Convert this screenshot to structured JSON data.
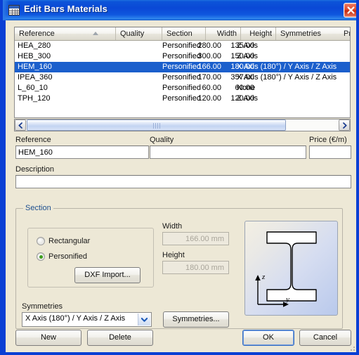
{
  "window": {
    "title": "Edit Bars Materials",
    "icon": "table-grid-icon",
    "close_label": "×",
    "accent_title_bg": "#0A48D6",
    "dialog_bg": "#EDE8D6",
    "selection_color": "#1B5FCC"
  },
  "table": {
    "columns": [
      {
        "label": "Reference",
        "align": "left",
        "sorted": true,
        "sort_dir": "asc"
      },
      {
        "label": "Quality",
        "align": "left"
      },
      {
        "label": "Section",
        "align": "left"
      },
      {
        "label": "Width",
        "align": "right"
      },
      {
        "label": "Height",
        "align": "right"
      },
      {
        "label": "Symmetries",
        "align": "left"
      },
      {
        "label": "Pri",
        "align": "left"
      }
    ],
    "rows": [
      {
        "reference": "HEA_280",
        "quality": "",
        "section": "Personified",
        "width": "280.00",
        "height": "135.00",
        "symmetries": "Z Axis",
        "selected": false
      },
      {
        "reference": "HEB_300",
        "quality": "",
        "section": "Personified",
        "width": "300.00",
        "height": "150.00",
        "symmetries": "Z Axis",
        "selected": false
      },
      {
        "reference": "HEM_160",
        "quality": "",
        "section": "Personified",
        "width": "166.00",
        "height": "180.00",
        "symmetries": "X Axis (180°) / Y Axis / Z Axis",
        "selected": true
      },
      {
        "reference": "IPEA_360",
        "quality": "",
        "section": "Personified",
        "width": "170.00",
        "height": "357.00",
        "symmetries": "X Axis (180°) / Y Axis / Z Axis",
        "selected": false
      },
      {
        "reference": "L_60_10",
        "quality": "",
        "section": "Personified",
        "width": "60.00",
        "height": "60.00",
        "symmetries": "None",
        "selected": false
      },
      {
        "reference": "TPH_120",
        "quality": "",
        "section": "Personified",
        "width": "120.00",
        "height": "120.00",
        "symmetries": "Z Axis",
        "selected": false
      }
    ]
  },
  "scrollbar": {
    "left_arrow": "‹",
    "right_arrow": "›"
  },
  "form": {
    "reference_label": "Reference",
    "reference_value": "HEM_160",
    "quality_label": "Quality",
    "quality_value": "",
    "price_label": "Price (€/m)",
    "price_value": "",
    "description_label": "Description",
    "description_value": ""
  },
  "section": {
    "group_title": "Section",
    "radio_rectangular": "Rectangular",
    "radio_personified": "Personified",
    "selected_radio": "Personified",
    "dxf_import_button": "DXF Import...",
    "width_label": "Width",
    "width_value": "166.00 mm",
    "height_label": "Height",
    "height_value": "180.00 mm",
    "symmetries_label": "Symmetries",
    "symmetries_value": "X Axis (180°) / Y Axis / Z Axis",
    "symmetries_button": "Symmetries...",
    "preview": {
      "shape": "i-beam-profile",
      "axis_vertical": "z",
      "axis_horizontal": "y"
    }
  },
  "footer": {
    "new_button": "New",
    "delete_button": "Delete",
    "ok_button": "OK",
    "cancel_button": "Cancel"
  }
}
